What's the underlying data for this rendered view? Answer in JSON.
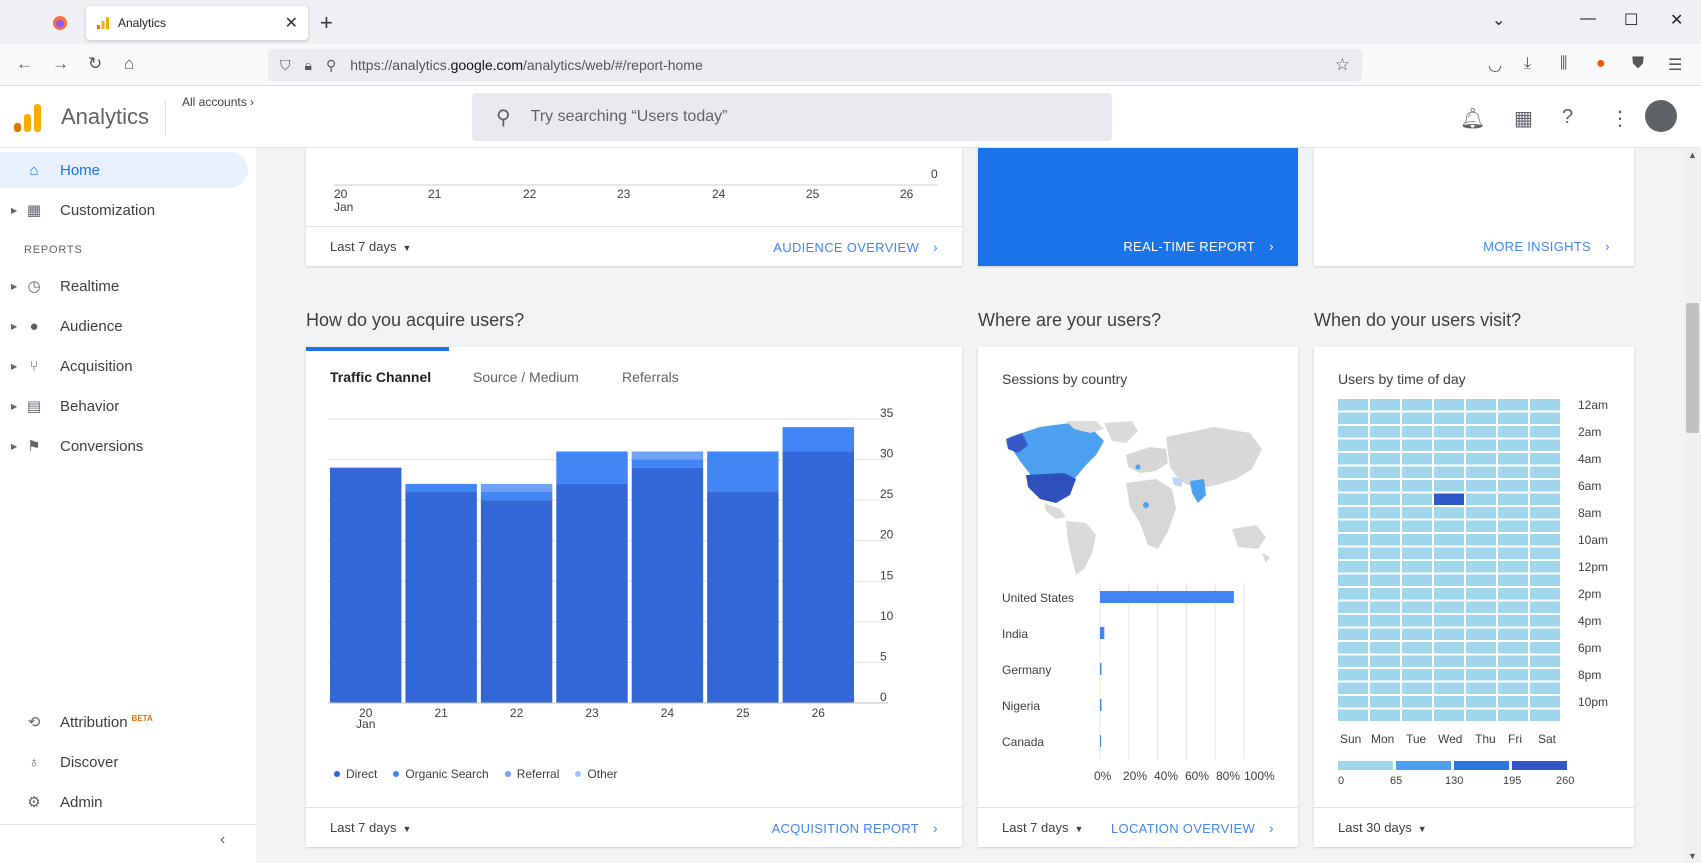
{
  "browser": {
    "tab_title": "Analytics",
    "url_host_prefix": "https://analytics.",
    "url_host": "google.com",
    "url_path": "/analytics/web/#/report-home"
  },
  "header": {
    "app_title": "Analytics",
    "all_accounts": "All accounts",
    "search_placeholder": "Try searching “Users today”"
  },
  "sidebar": {
    "reports_label": "REPORTS",
    "items": [
      {
        "label": "Home",
        "icon": "home-icon"
      },
      {
        "label": "Customization",
        "icon": "dashboard-icon"
      },
      {
        "label": "Realtime",
        "icon": "clock-icon"
      },
      {
        "label": "Audience",
        "icon": "person-icon"
      },
      {
        "label": "Acquisition",
        "icon": "acquisition-icon"
      },
      {
        "label": "Behavior",
        "icon": "behavior-icon"
      },
      {
        "label": "Conversions",
        "icon": "flag-icon"
      }
    ],
    "bottom_items": [
      {
        "label": "Attribution",
        "badge": "BETA",
        "icon": "attribution-icon"
      },
      {
        "label": "Discover",
        "icon": "lightbulb-icon"
      },
      {
        "label": "Admin",
        "icon": "gear-icon"
      }
    ]
  },
  "top_cards": {
    "audience": {
      "range": "Last 7 days",
      "link": "AUDIENCE OVERVIEW",
      "x_ticks": [
        "20",
        "21",
        "22",
        "23",
        "24",
        "25",
        "26"
      ],
      "x_sub": "Jan",
      "y_zero": "0"
    },
    "realtime": {
      "link": "REAL-TIME REPORT"
    },
    "insights": {
      "link": "MORE INSIGHTS"
    }
  },
  "acquire": {
    "title": "How do you acquire users?",
    "tabs": [
      "Traffic Channel",
      "Source / Medium",
      "Referrals"
    ],
    "range": "Last 7 days",
    "link": "ACQUISITION REPORT"
  },
  "location": {
    "title": "Where are your users?",
    "subtitle": "Sessions by country",
    "countries": [
      "United States",
      "India",
      "Germany",
      "Nigeria",
      "Canada"
    ],
    "country_values_pct": [
      93,
      3,
      1,
      1,
      0
    ],
    "pct_ticks": [
      "0%",
      "20%",
      "40%",
      "60%",
      "80%",
      "100%"
    ],
    "range": "Last 7 days",
    "link": "LOCATION OVERVIEW"
  },
  "visit": {
    "title": "When do your users visit?",
    "subtitle": "Users by time of day",
    "days": [
      "Sun",
      "Mon",
      "Tue",
      "Wed",
      "Thu",
      "Fri",
      "Sat"
    ],
    "hour_labels": [
      "12am",
      "2am",
      "4am",
      "6am",
      "8am",
      "10am",
      "12pm",
      "2pm",
      "4pm",
      "6pm",
      "8pm",
      "10pm"
    ],
    "legend_ticks": [
      "0",
      "65",
      "130",
      "195",
      "260"
    ],
    "highlight": {
      "day": "Wed",
      "hour": "7am"
    },
    "range": "Last 30 days"
  },
  "colors": {
    "direct": "#3366d6",
    "organic": "#4285f4",
    "referral": "#6fa1f5",
    "other": "#a0c3f8",
    "accent": "#1a73e8",
    "heat_low": "#9fd6ec",
    "heat_high": "#3056c7"
  },
  "chart_data": {
    "type": "bar",
    "stacked": true,
    "categories": [
      "20 Jan",
      "21",
      "22",
      "23",
      "24",
      "25",
      "26"
    ],
    "tick_labels": [
      [
        "20",
        "Jan"
      ],
      [
        "21"
      ],
      [
        "22"
      ],
      [
        "23"
      ],
      [
        "24"
      ],
      [
        "25"
      ],
      [
        "26"
      ]
    ],
    "y_ticks": [
      "35",
      "30",
      "25",
      "20",
      "15",
      "10",
      "5",
      "0"
    ],
    "ylim": [
      0,
      35
    ],
    "legend_position": "bottom-left",
    "series": [
      {
        "name": "Direct",
        "values": [
          29,
          26,
          25,
          27,
          29,
          26,
          31
        ]
      },
      {
        "name": "Organic Search",
        "values": [
          0,
          1,
          1,
          4,
          1,
          5,
          3
        ]
      },
      {
        "name": "Referral",
        "values": [
          0,
          0,
          1,
          0,
          1,
          0,
          0
        ]
      },
      {
        "name": "Other",
        "values": [
          0,
          0,
          0,
          0,
          0,
          0,
          0
        ]
      }
    ]
  }
}
